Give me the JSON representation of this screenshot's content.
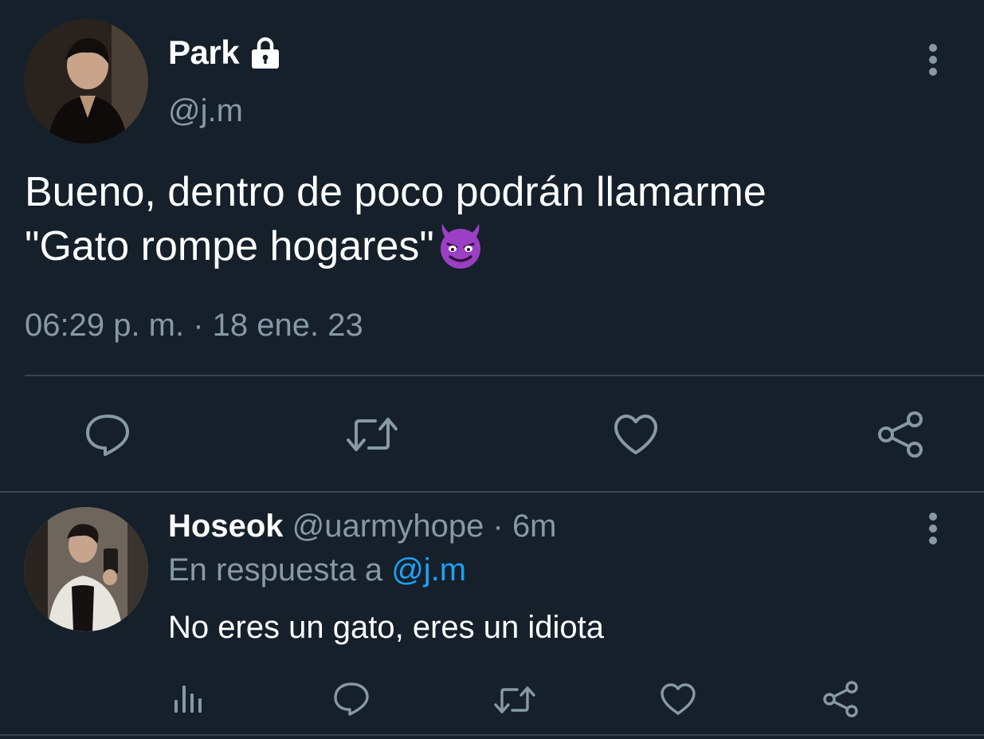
{
  "main_tweet": {
    "display_name": "Park",
    "handle": "@j.m",
    "text_line1": "Bueno, dentro de poco podrán llamarme",
    "text_line2": "\"Gato rompe hogares\"",
    "emoji": "smiling-face-with-horns",
    "timestamp": "06:29 p. m. · 18 ene. 23",
    "actions": [
      "reply-icon",
      "retweet-icon",
      "like-icon",
      "share-icon"
    ]
  },
  "reply_tweet": {
    "display_name": "Hoseok",
    "handle": "@uarmyhope",
    "separator": "·",
    "time": "6m",
    "reply_prefix": "En respuesta a",
    "reply_mention": "@j.m",
    "text": "No eres un gato, eres un idiota",
    "actions": [
      "analytics-icon",
      "reply-icon",
      "retweet-icon",
      "like-icon",
      "share-icon"
    ]
  },
  "colors": {
    "background": "#15202b",
    "secondary_text": "#8899a6",
    "divider": "#38444d",
    "link": "#1da1f2",
    "primary_text": "#ffffff"
  }
}
